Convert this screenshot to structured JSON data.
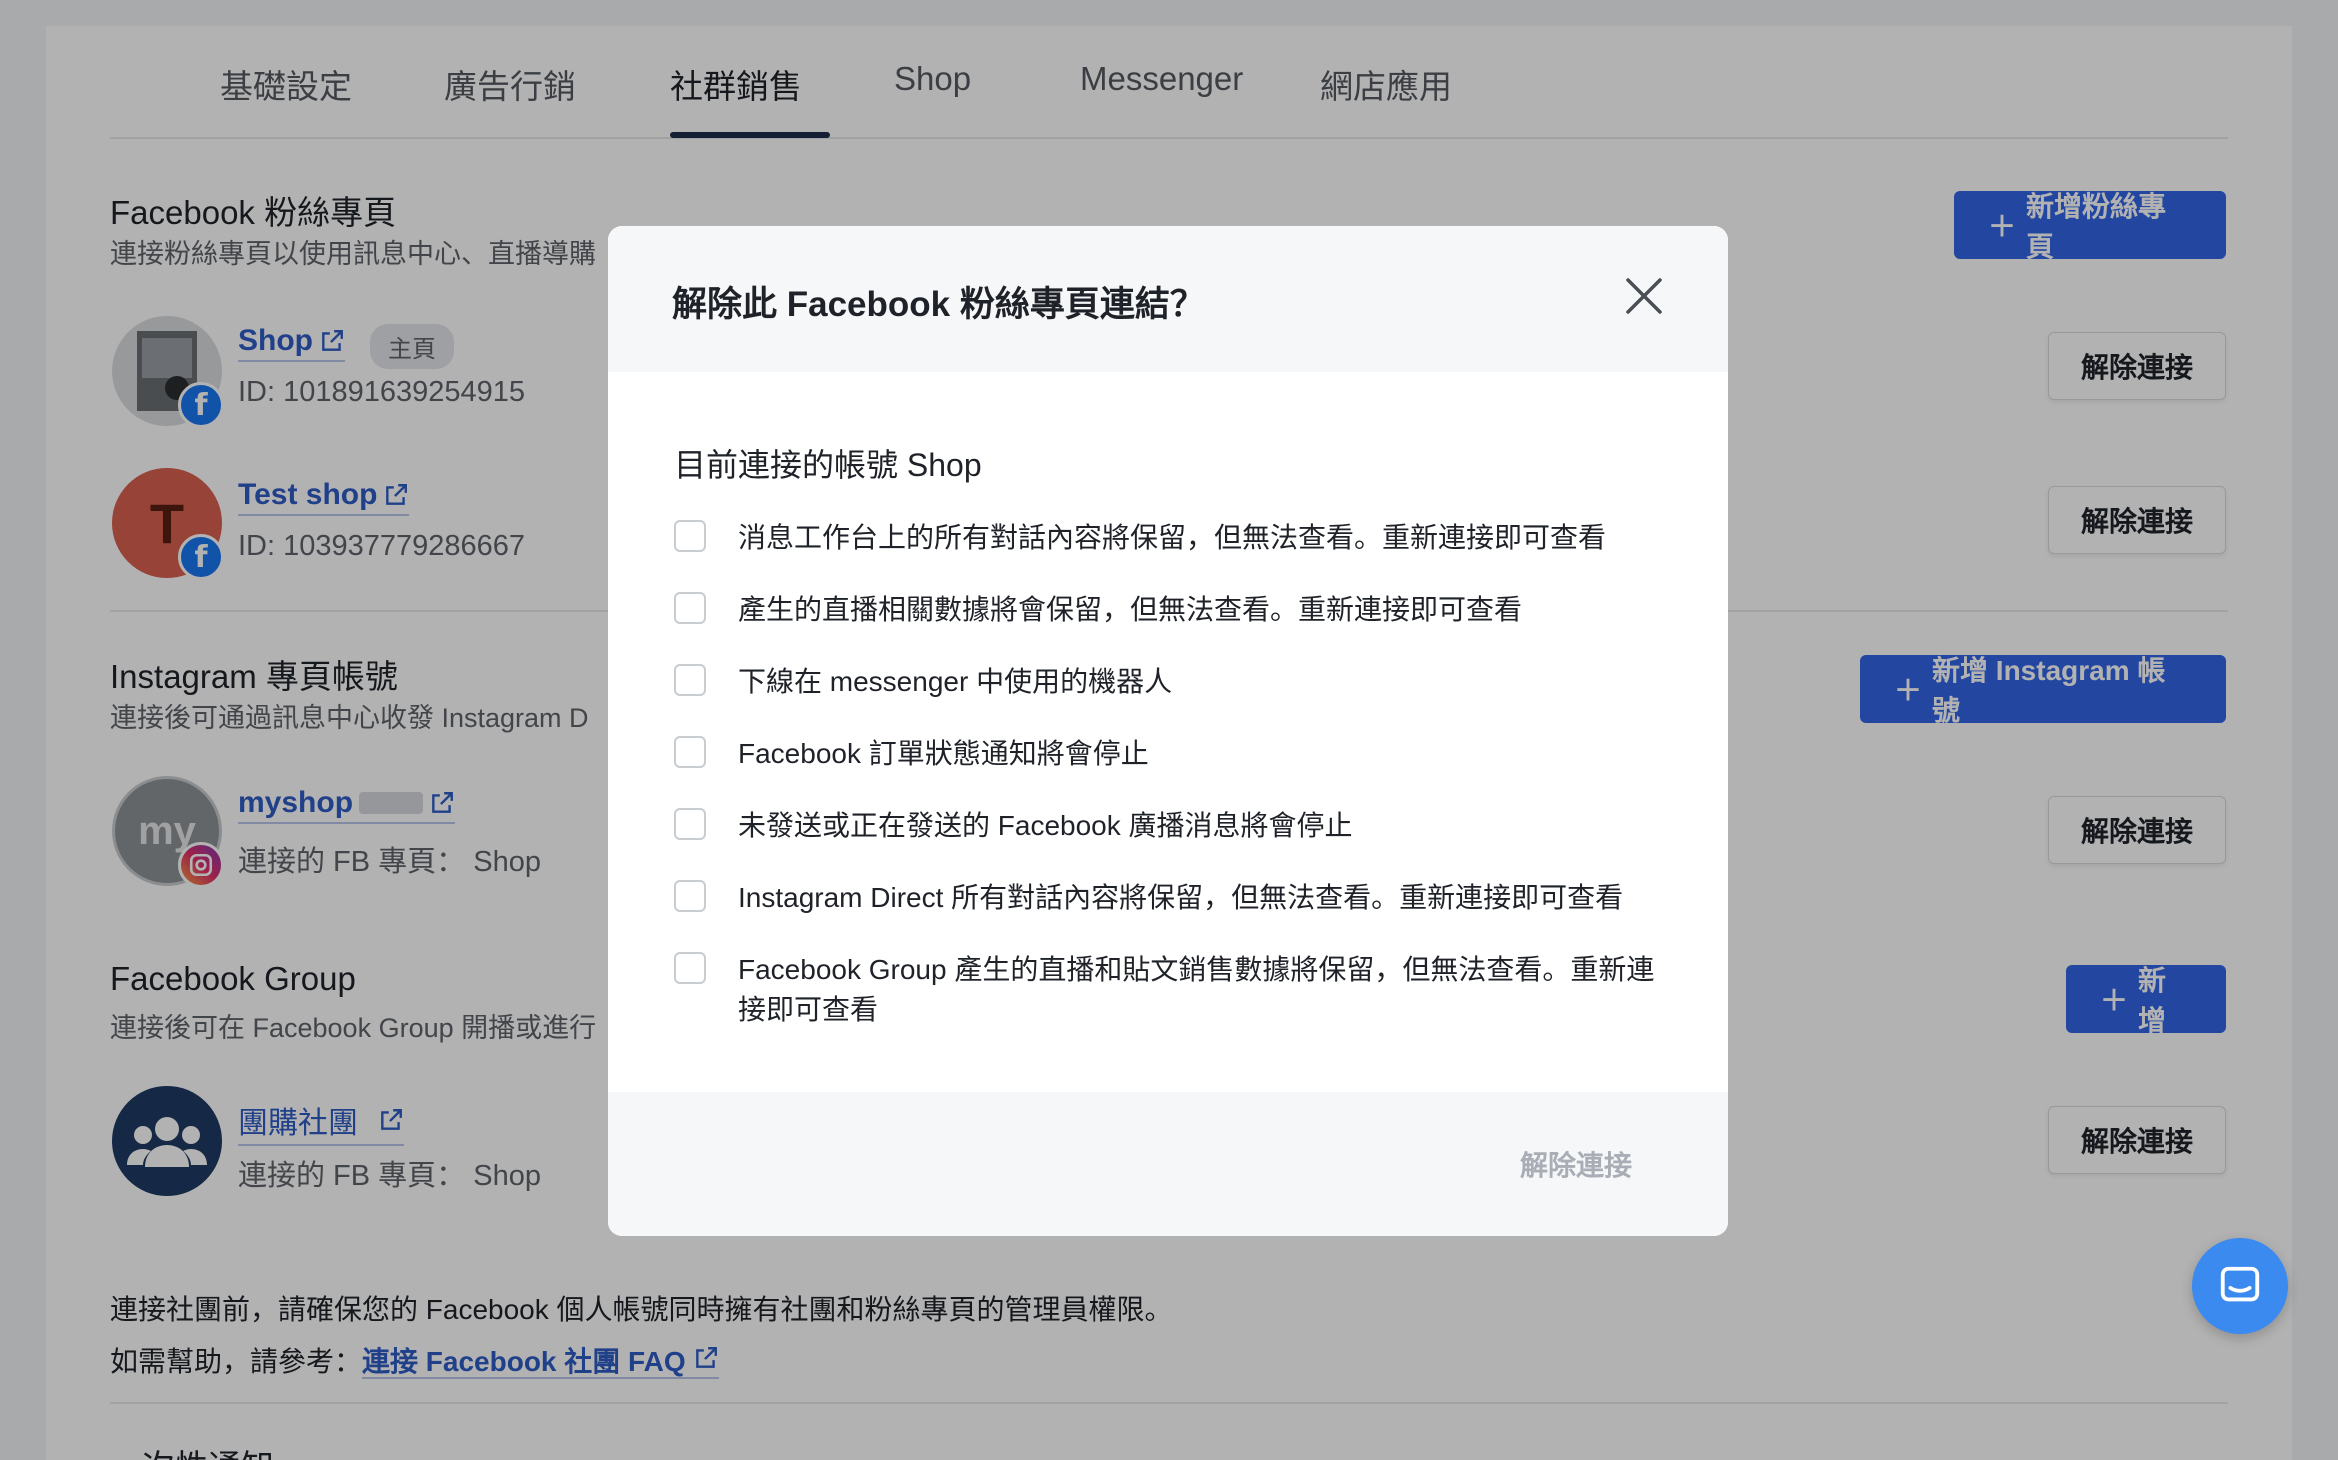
{
  "tabs": [
    {
      "label": "基礎設定"
    },
    {
      "label": "廣告行銷"
    },
    {
      "label": "社群銷售"
    },
    {
      "label": "Shop"
    },
    {
      "label": "Messenger"
    },
    {
      "label": "網店應用"
    }
  ],
  "fb_pages": {
    "title": "Facebook 粉絲專頁",
    "desc": "連接粉絲專頁以使用訊息中心、直播導購",
    "add_label": "新增粉絲專頁",
    "accounts": [
      {
        "name": "Shop",
        "tag": "主頁",
        "id": "ID: 101891639254915",
        "avatar_letter": "",
        "disconnect": "解除連接"
      },
      {
        "name": "Test shop",
        "id": "ID: 103937779286667",
        "avatar_letter": "T",
        "disconnect": "解除連接"
      }
    ]
  },
  "instagram": {
    "title": "Instagram 專頁帳號",
    "desc": "連接後可通過訊息中心收發 Instagram D",
    "add_label": "新增 Instagram 帳號",
    "accounts": [
      {
        "name": "myshop",
        "sub": "連接的 FB 專頁： Shop",
        "avatar_letter": "my",
        "disconnect": "解除連接"
      }
    ]
  },
  "fb_group": {
    "title": "Facebook Group",
    "desc": "連接後可在 Facebook Group 開播或進行",
    "add_label": "新增",
    "accounts": [
      {
        "name": "團購社團",
        "sub": "連接的 FB 專頁： Shop",
        "disconnect": "解除連接"
      }
    ]
  },
  "footer": {
    "line1": "連接社團前，請確保您的 Facebook 個人帳號同時擁有社團和粉絲專頁的管理員權限。",
    "line2_prefix": "如需幫助，請參考：",
    "line2_link": "連接 Facebook 社團 FAQ"
  },
  "next_section": {
    "title": "次性通知"
  },
  "modal": {
    "title": "解除此 Facebook 粉絲專頁連結？",
    "subtitle": "目前連接的帳號 Shop",
    "options": [
      "消息工作台上的所有對話內容將保留，但無法查看。重新連接即可查看",
      "產生的直播相關數據將會保留，但無法查看。重新連接即可查看",
      "下線在 messenger 中使用的機器人",
      "Facebook 訂單狀態通知將會停止",
      "未發送或正在發送的 Facebook 廣播消息將會停止",
      "Instagram Direct 所有對話內容將保留，但無法查看。重新連接即可查看",
      "Facebook Group 產生的直播和貼文銷售數據將保留，但無法查看。重新連接即可查看"
    ],
    "confirm_label": "解除連接"
  },
  "colors": {
    "primary": "#3366e6",
    "link": "#2e5cc6",
    "overlay": "rgba(0,0,0,0.3)"
  }
}
